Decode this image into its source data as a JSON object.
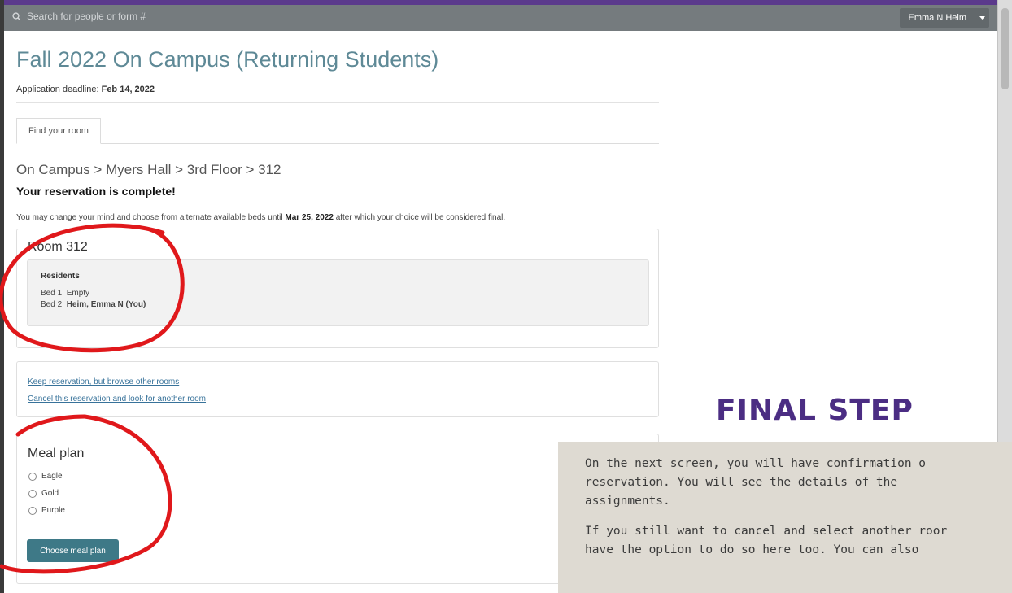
{
  "topbar": {
    "search_placeholder": "Search for people or form #",
    "user_name": "Emma N Heim"
  },
  "page": {
    "title": "Fall 2022 On Campus (Returning Students)",
    "deadline_label": "Application deadline:",
    "deadline_date": "Feb 14, 2022"
  },
  "tabs": [
    {
      "label": "Find your room"
    }
  ],
  "breadcrumb": "On Campus > Myers Hall > 3rd Floor > 312",
  "status_heading": "Your reservation is complete!",
  "notice": {
    "before": "You may change your mind and choose from alternate available beds until",
    "date": "Mar 25, 2022",
    "after": "after which your choice will be considered final."
  },
  "room": {
    "title": "Room 312",
    "residents_label": "Residents",
    "bed1_label": "Bed 1:",
    "bed1_value": "Empty",
    "bed2_label": "Bed 2:",
    "bed2_value": "Heim, Emma N (You)"
  },
  "links": {
    "keep": "Keep reservation, but browse other rooms",
    "cancel": "Cancel this reservation and look for another room"
  },
  "meal": {
    "title": "Meal plan",
    "options": [
      "Eagle",
      "Gold",
      "Purple"
    ],
    "button": "Choose meal plan"
  },
  "overlay": {
    "heading": "FINAL STEP",
    "lines": [
      "On the next screen, you will have confirmation o",
      "reservation.  You will see the details of the",
      "assignments.",
      "If you still want to cancel and select another roor",
      "have the option to do so here too.  You can also",
      "",
      ""
    ]
  },
  "colors": {
    "brand_purple": "#4b2d83",
    "title_teal": "#5e8996",
    "button_teal": "#3e7987",
    "annotation_red": "#e0181b"
  }
}
